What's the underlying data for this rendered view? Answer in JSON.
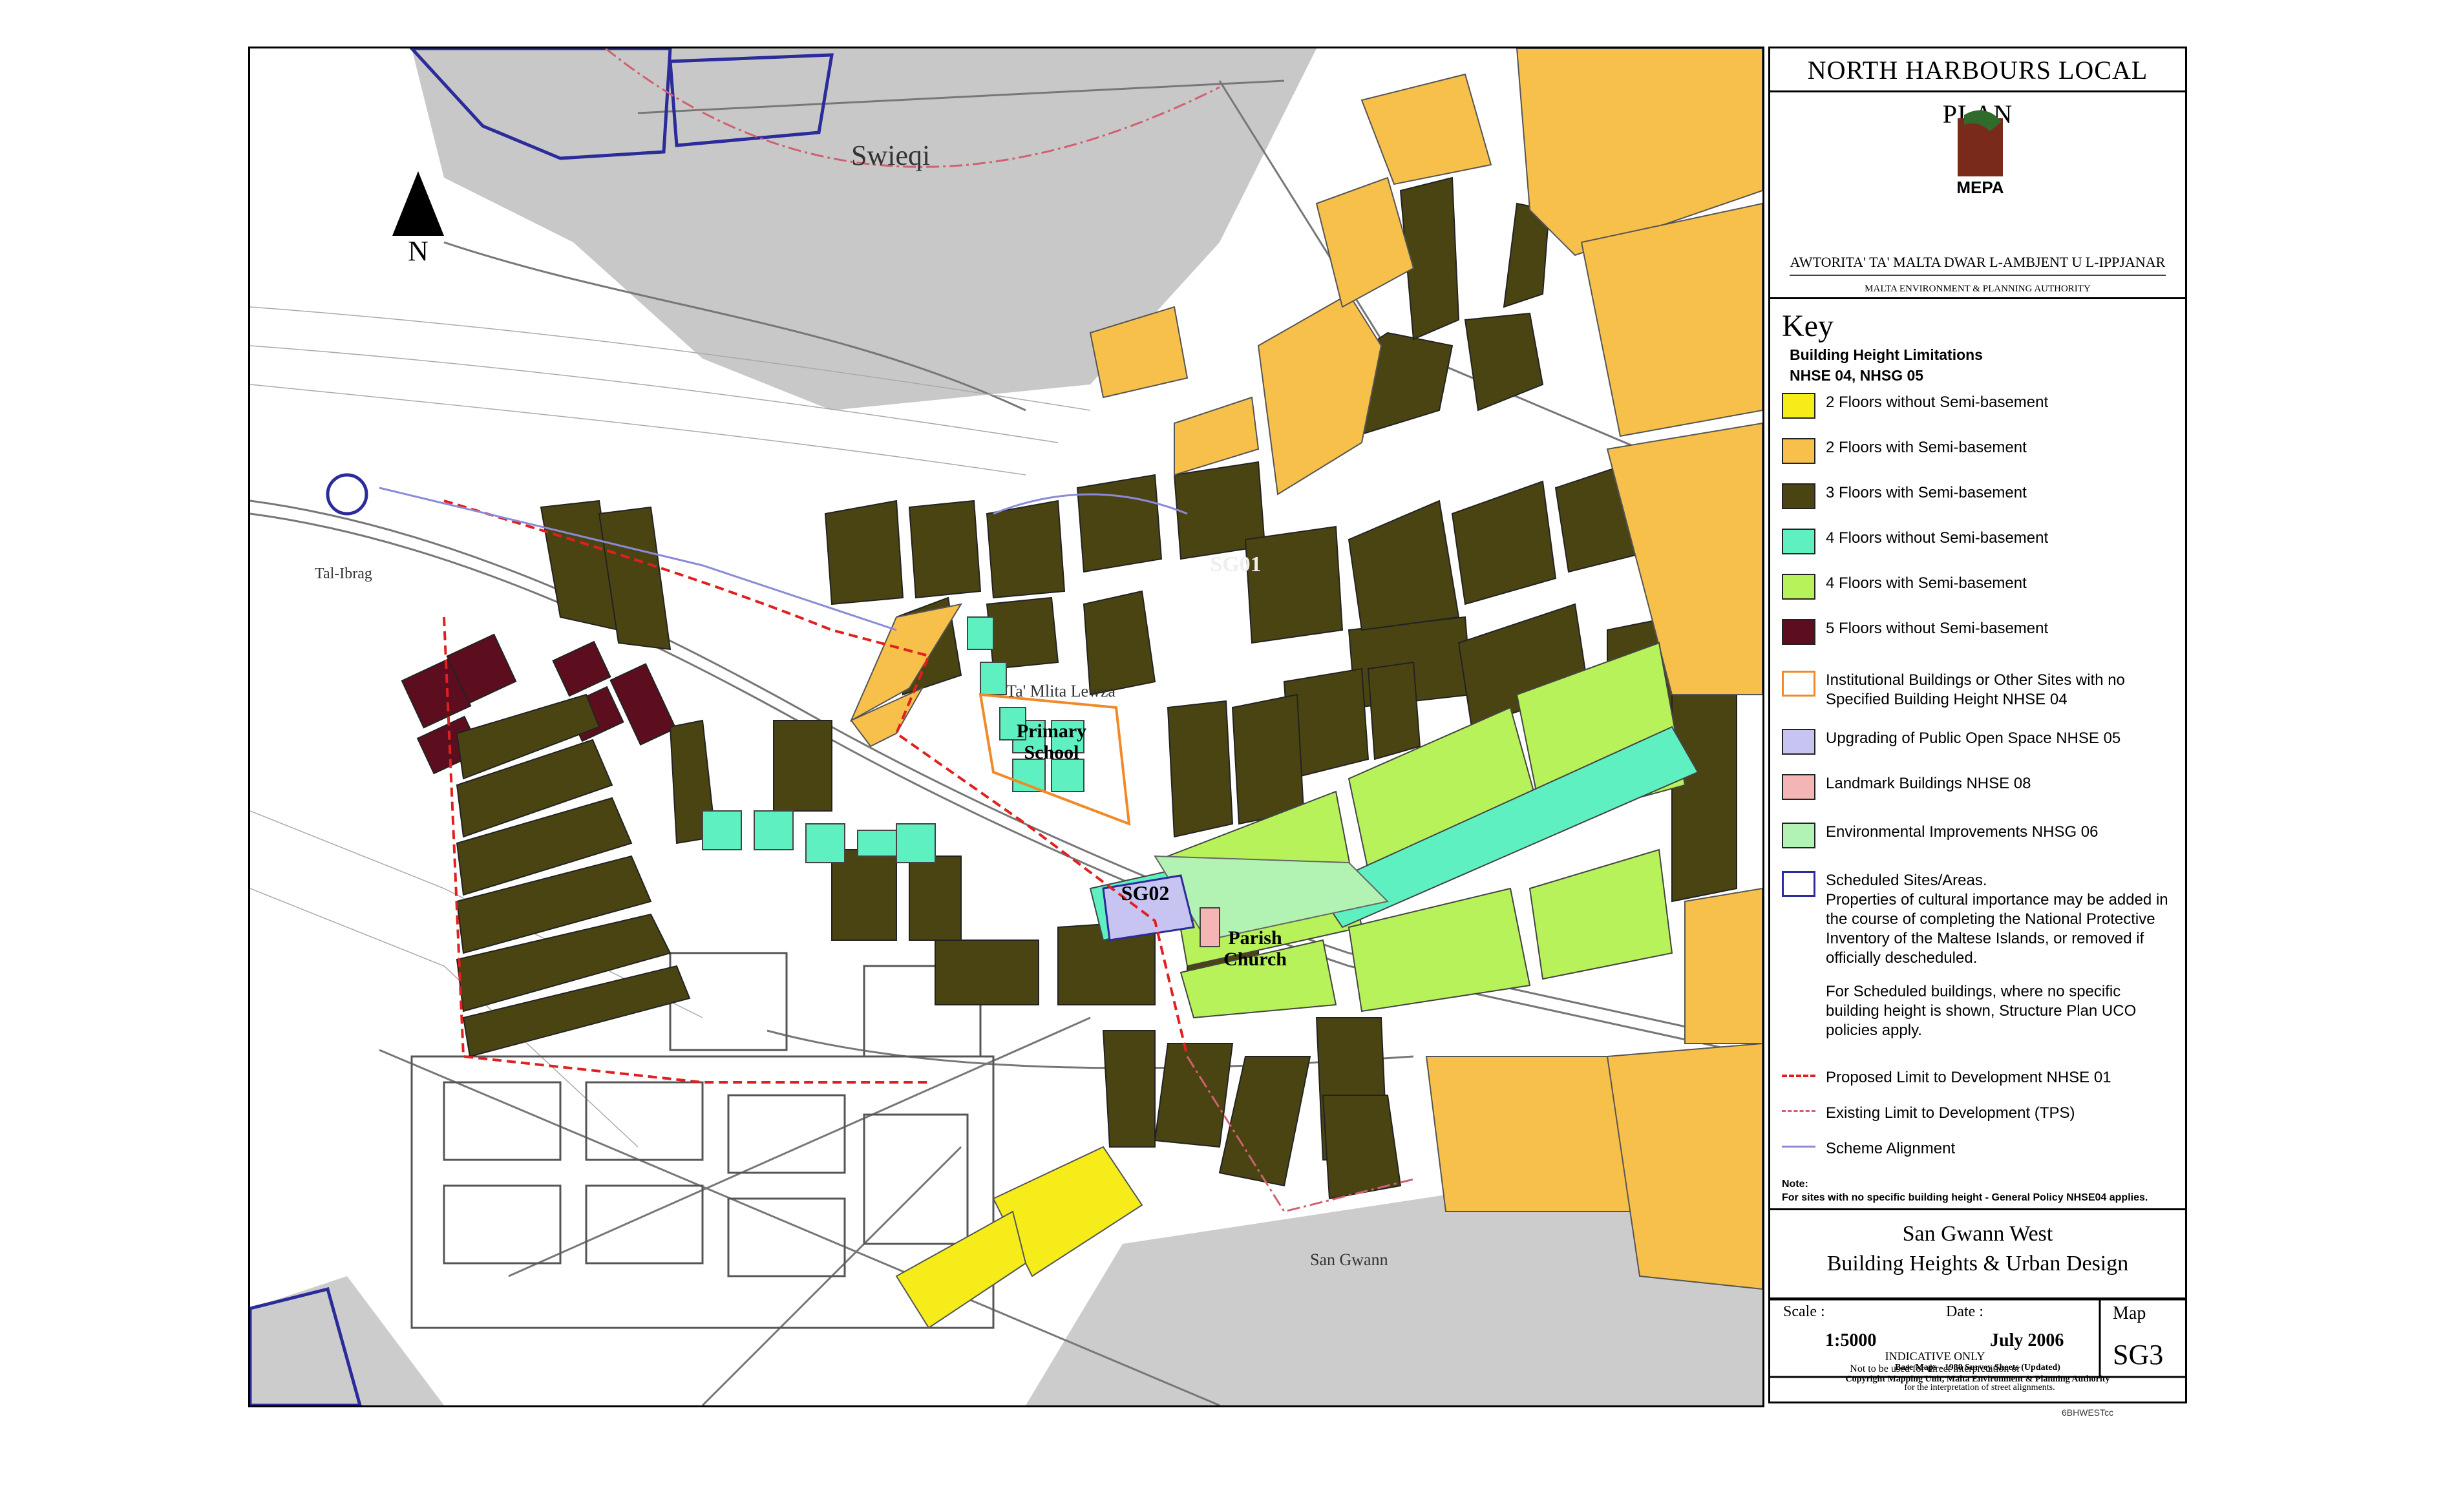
{
  "colors": {
    "two_floors_no_semi": "#f5ec1a",
    "two_floors_semi": "#f7c04a",
    "three_floors_semi": "#4a4413",
    "four_floors_no_semi": "#5ff0c2",
    "four_floors_semi": "#b7f25a",
    "five_floors_no_semi": "#5c0e1e",
    "institutional": "#f08a28",
    "public_open_space": "#c7c4f2",
    "landmark": "#f5b5b5",
    "environmental": "#b2f2b2",
    "scheduled": "#2b2b9a",
    "development_limit": "#e02020",
    "existing_limit": "#d06070",
    "scheme_alignment": "#8a8ad8"
  },
  "map": {
    "north_label": "N",
    "place_labels": [
      "Swieqi",
      "Tal-Ibrag",
      "Ta' Mlita Lewza",
      "San Gwann"
    ],
    "site_labels": {
      "primary_school": "Primary School",
      "sg01": "SG01",
      "sg02": "SG02",
      "parish_church": "Parish Church"
    },
    "icons": [
      "north-arrow-icon"
    ]
  },
  "panel": {
    "plan_title": "NORTH HARBOURS LOCAL PLAN",
    "logo_text": "MEPA",
    "authority_mt": "AWTORITA' TA' MALTA DWAR L-AMBJENT U L-IPPJANAR",
    "authority_en": "MALTA ENVIRONMENT & PLANNING AUTHORITY",
    "key": {
      "title": "Key",
      "heading_1": "Building Height Limitations",
      "heading_2": "NHSE 04, NHSG 05",
      "items": [
        {
          "label": "2 Floors without Semi-basement"
        },
        {
          "label": "2 Floors with Semi-basement"
        },
        {
          "label": "3 Floors with Semi-basement"
        },
        {
          "label": "4 Floors without Semi-basement"
        },
        {
          "label": "4 Floors with Semi-basement"
        },
        {
          "label": "5 Floors without Semi-basement"
        },
        {
          "label": "Institutional Buildings or Other Sites with no Specified Building Height NHSE 04"
        },
        {
          "label": "Upgrading of Public Open Space NHSE 05"
        },
        {
          "label": "Landmark Buildings NHSE 08"
        },
        {
          "label": "Environmental Improvements NHSG 06"
        }
      ],
      "scheduled": {
        "label": "Scheduled Sites/Areas.",
        "text_1": "Properties of cultural importance may be added in the course of completing the National Protective Inventory of the Maltese Islands, or removed if officially descheduled.",
        "text_2": "For Scheduled buildings, where no specific building height is shown, Structure Plan UCO policies apply."
      },
      "lines": [
        {
          "label": "Proposed Limit to Development NHSE 01"
        },
        {
          "label": "Existing Limit to Development (TPS)"
        },
        {
          "label": "Scheme Alignment"
        }
      ],
      "note_title": "Note:",
      "note_text": "For sites with no specific building height - General Policy NHSE04 applies."
    },
    "map_title_1": "San Gwann West",
    "map_title_2": "Building Heights & Urban Design",
    "scale_label": "Scale :",
    "scale_value": "1:5000",
    "date_label": "Date :",
    "date_value": "July 2006",
    "indicative": "INDICATIVE ONLY",
    "disclaimer_1": "Not to be used for direct interpretation or",
    "disclaimer_2": "for the interpretation of street alignments.",
    "map_label": "Map",
    "map_number": "SG3",
    "base_maps": "Base Maps - 1988 Survey Sheets (Updated)",
    "copyright": "Copyright Mapping Unit, Malta Environment & Planning Authority",
    "file_ref": "6BHWESTcc"
  }
}
